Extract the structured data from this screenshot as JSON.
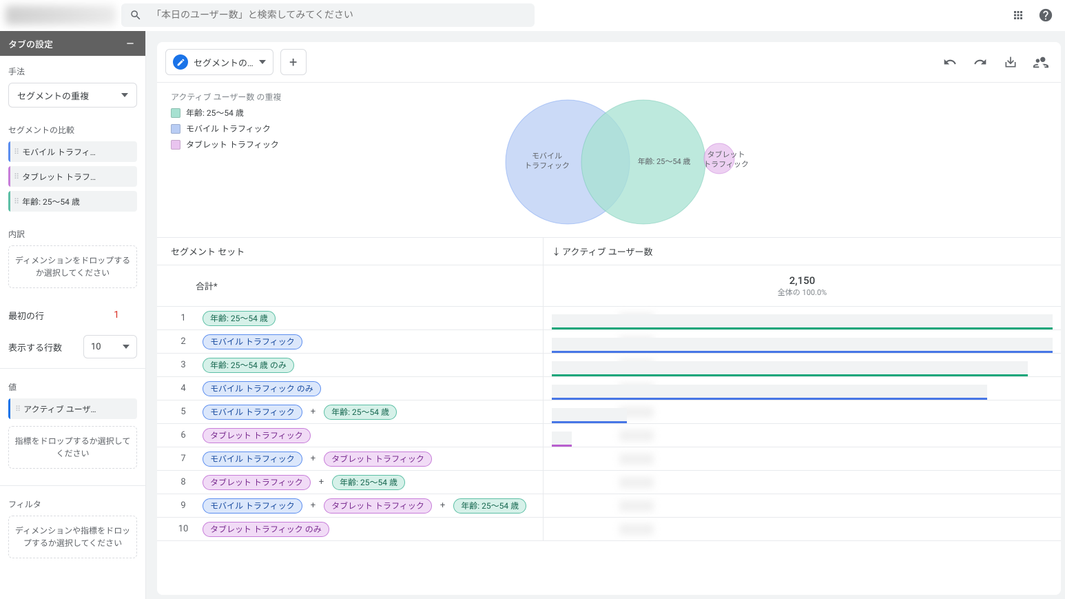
{
  "search": {
    "placeholder": "「本日のユーザー数」と検索してみてください"
  },
  "sidebar": {
    "title": "タブの設定",
    "method_label": "手法",
    "method_value": "セグメントの重複",
    "compare_label": "セグメントの比較",
    "segments": [
      {
        "label": "モバイル トラフィ…",
        "cls": "blue"
      },
      {
        "label": "タブレット トラフ…",
        "cls": "purple"
      },
      {
        "label": "年齢: 25～54 歳",
        "cls": "teal"
      }
    ],
    "breakdown_label": "内訳",
    "breakdown_drop": "ディメンションをドロップするか選択してください",
    "first_row_label": "最初の行",
    "first_row_value": "1",
    "rows_label": "表示する行数",
    "rows_value": "10",
    "value_label": "値",
    "value_chip": "アクティブ ユーザ…",
    "metric_drop": "指標をドロップするか選択してください",
    "filter_label": "フィルタ",
    "filter_drop": "ディメンションや指標をドロップするか選択してください"
  },
  "tab": {
    "label": "セグメントの…"
  },
  "venn": {
    "title": "アクティブ ユーザー数 の重複",
    "legend": [
      {
        "label": "年齢: 25～54 歳",
        "cls": "sw-teal"
      },
      {
        "label": "モバイル トラフィック",
        "cls": "sw-blue"
      },
      {
        "label": "タブレット トラフィック",
        "cls": "sw-purple"
      }
    ],
    "label_mobile_1": "モバイル",
    "label_mobile_2": "トラフィック",
    "label_age": "年齢: 25～54 歳",
    "label_tab_1": "タブレット",
    "label_tab_2": "トラフィック"
  },
  "table": {
    "col1": "セグメント セット",
    "col2": "アクティブ ユーザー数",
    "total_label": "合計*",
    "total_value": "2,150",
    "total_sub": "全体の 100.0%",
    "labels": {
      "age": "年齢: 25～54 歳",
      "age_only": "年齢: 25～54 歳 のみ",
      "mobile": "モバイル トラフィック",
      "mobile_only": "モバイル トラフィック のみ",
      "tablet": "タブレット トラフィック",
      "tablet_only": "タブレット トラフィック のみ"
    }
  },
  "chart_data": {
    "type": "bar",
    "title": "アクティブ ユーザー数",
    "xlabel": "セグメント セット",
    "total": 2150,
    "series": [
      {
        "name": "年齢: 25～54 歳",
        "pct": 100,
        "color": "teal"
      },
      {
        "name": "モバイル トラフィック",
        "pct": 100,
        "color": "blue"
      },
      {
        "name": "年齢: 25～54 歳 のみ",
        "pct": 95,
        "color": "teal"
      },
      {
        "name": "モバイル トラフィック のみ",
        "pct": 87,
        "color": "blue"
      },
      {
        "name": "モバイル トラフィック + 年齢: 25～54 歳",
        "pct": 15,
        "color": "blue"
      },
      {
        "name": "タブレット トラフィック",
        "pct": 4,
        "color": "purple"
      },
      {
        "name": "モバイル トラフィック + タブレット トラフィック",
        "pct": 0,
        "color": "blue"
      },
      {
        "name": "タブレット トラフィック + 年齢: 25～54 歳",
        "pct": 0,
        "color": "purple"
      },
      {
        "name": "モバイル トラフィック + タブレット トラフィック + 年齢: 25～54 歳",
        "pct": 0,
        "color": "blue"
      },
      {
        "name": "タブレット トラフィック のみ",
        "pct": 0,
        "color": "purple"
      }
    ]
  }
}
